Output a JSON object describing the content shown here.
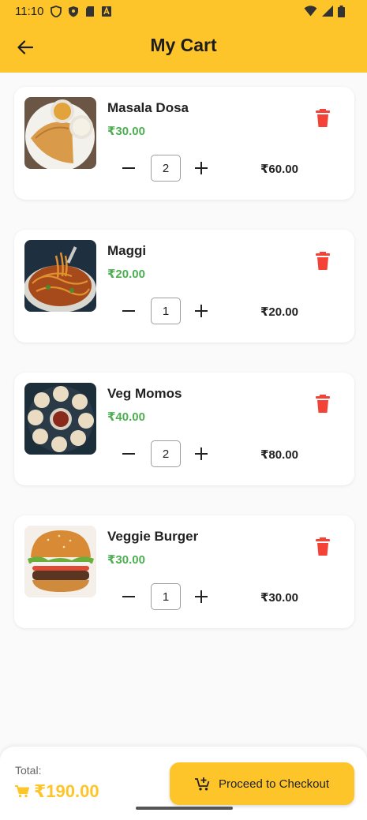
{
  "status_bar": {
    "time": "11:10"
  },
  "app_bar": {
    "title": "My Cart"
  },
  "cart": {
    "items": [
      {
        "name": "Masala Dosa",
        "price": "₹30.00",
        "quantity": "2",
        "line_total": "₹60.00"
      },
      {
        "name": "Maggi",
        "price": "₹20.00",
        "quantity": "1",
        "line_total": "₹20.00"
      },
      {
        "name": "Veg Momos",
        "price": "₹40.00",
        "quantity": "2",
        "line_total": "₹80.00"
      },
      {
        "name": "Veggie Burger",
        "price": "₹30.00",
        "quantity": "1",
        "line_total": "₹30.00"
      }
    ]
  },
  "footer": {
    "total_label": "Total:",
    "total_amount": "₹190.00",
    "checkout_label": "Proceed to Checkout"
  },
  "colors": {
    "accent": "#fec52b",
    "price": "#4caf50",
    "delete": "#f44336"
  }
}
